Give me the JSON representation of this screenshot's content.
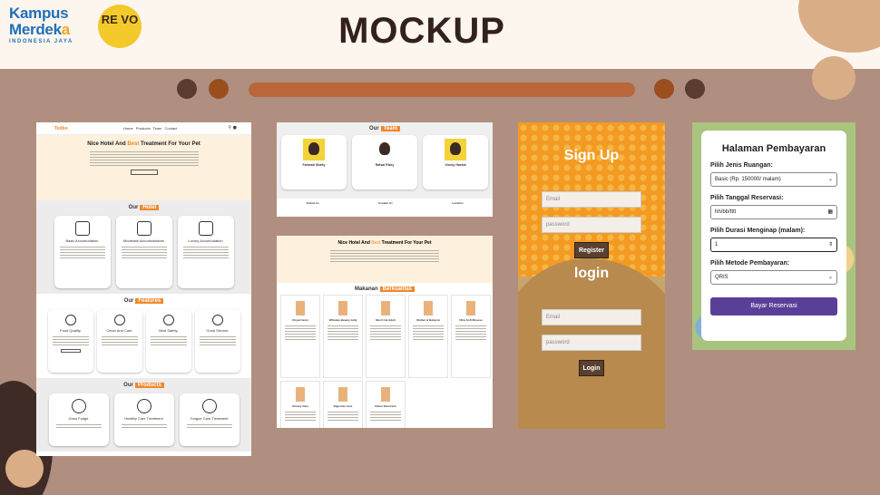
{
  "header": {
    "title": "MOCKUP",
    "logo_line1": "Kampus",
    "logo_line2a": "Merdek",
    "logo_line2b": "a",
    "logo_line3": "INDONESIA JAYA",
    "revo_text": "RE VO"
  },
  "colors": {
    "accent": "#f0882a",
    "brown": "#33211c",
    "bg": "#b08f80"
  },
  "website": {
    "brand": "Tedbo",
    "nav_links": "Home Products Team Contact",
    "hero_title_pre": "Nice Hotel And ",
    "hero_title_em": "Best",
    "hero_title_post": " Treatment For Your Pet",
    "section_hotel_a": "Our",
    "section_hotel_b": "Hotel",
    "hotel_cards": [
      "Basic Accomodation",
      "Moderate Accomodations",
      "Luxury Accomodation"
    ],
    "section_features_a": "Our",
    "section_features_b": "Features",
    "feature_cards": [
      "Food Quality",
      "Clean And Care",
      "Best Safety",
      "Good Service"
    ],
    "section_products_a": "Our",
    "section_products_b": "Products",
    "product_cards": [
      "Grow Fudge",
      "Healthy Care Treatment",
      "Tongue Care Treatment"
    ]
  },
  "team": {
    "heading_a": "Our",
    "heading_b": "Team",
    "members": [
      {
        "name": "Fatimah Shafiy"
      },
      {
        "name": "Rafsal Rizky"
      },
      {
        "name": "Viccky Haekal"
      }
    ],
    "footer": [
      "Follow Us",
      "Contact Us",
      "Location"
    ]
  },
  "makanan": {
    "hero_title_pre": "Nice Hotel And ",
    "hero_title_em": "Best",
    "hero_title_post": " Treatment For Your Pet",
    "heading_a": "Makanan",
    "heading_b": "Berkualitas",
    "items": [
      "Royal Canin",
      "Whiskas Beauty Jelly",
      "Me-O Cat Adult",
      "Mother & Babycat",
      "Ultra Soft Mousse",
      "Urinary Care",
      "Digestive Care",
      "Kitten Shortrack"
    ]
  },
  "auth": {
    "signup_title": "Sign Up",
    "signup_email": "Email",
    "signup_password": "password",
    "register_label": "Register",
    "login_title": "login",
    "login_email": "Email",
    "login_password": "password",
    "login_label": "Login"
  },
  "payment": {
    "title": "Halaman Pembayaran",
    "room_label": "Pilih Jenis Ruangan:",
    "room_value": "Basic (Rp. 150000/ malam)",
    "date_label": "Pilih Tanggal Reservasi:",
    "date_value": "hh/bb/tttt",
    "duration_label": "Pilih Durasi Menginap (malam):",
    "duration_value": "1",
    "method_label": "Pilih Metode Pembayaran:",
    "method_value": "QRIS",
    "submit_label": "Bayar Reservasi"
  }
}
